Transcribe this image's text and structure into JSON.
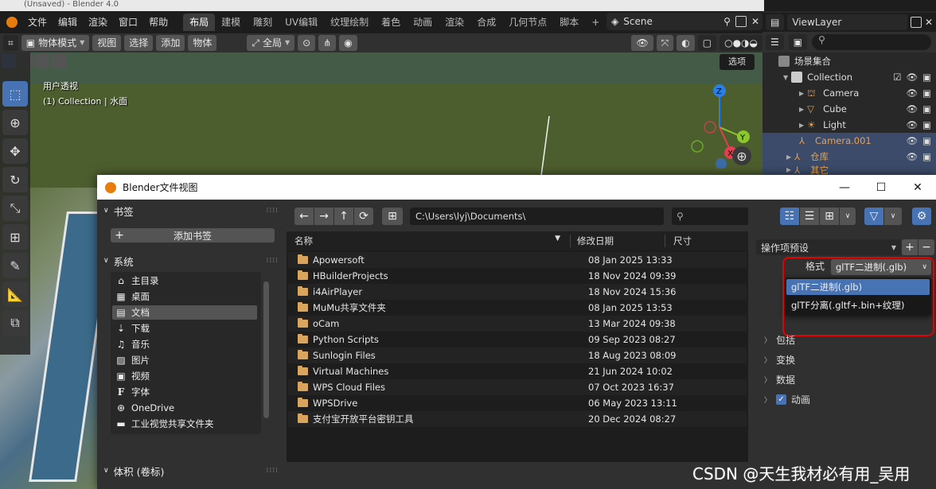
{
  "app": {
    "window_title": "(Unsaved) - Blender 4.0",
    "menu": [
      "文件",
      "编辑",
      "渲染",
      "窗口",
      "帮助"
    ],
    "workspaces": [
      "布局",
      "建模",
      "雕刻",
      "UV编辑",
      "纹理绘制",
      "着色",
      "动画",
      "渲染",
      "合成",
      "几何节点",
      "脚本"
    ],
    "active_workspace": "布局",
    "add_workspace": "+",
    "scene": "Scene",
    "view_layer": "ViewLayer"
  },
  "viewport": {
    "mode": "物体模式",
    "header_menus": [
      "视图",
      "选择",
      "添加",
      "物体"
    ],
    "orientation": "全局",
    "label_view": "用户透视",
    "label_collection": "(1) Collection | 水面",
    "select_button": "选项",
    "gizmo_axes": [
      "Z",
      "Y",
      "X"
    ]
  },
  "outliner": {
    "rows": [
      {
        "label": "场景集合",
        "depth": 0
      },
      {
        "label": "Collection",
        "depth": 1
      },
      {
        "label": "Camera",
        "depth": 2
      },
      {
        "label": "Cube",
        "depth": 2
      },
      {
        "label": "Light",
        "depth": 2
      },
      {
        "label": "Camera.001",
        "depth": 1
      },
      {
        "label": "仓库",
        "depth": 1
      },
      {
        "label": "其它",
        "depth": 1
      }
    ]
  },
  "dialog": {
    "title": "Blender文件视图",
    "bookmarks_header": "书签",
    "add_bookmark": "添加书签",
    "system_header": "系统",
    "system_items": [
      {
        "icon": "home-icon",
        "label": "主目录"
      },
      {
        "icon": "desktop-icon",
        "label": "桌面"
      },
      {
        "icon": "documents-icon",
        "label": "文档"
      },
      {
        "icon": "download-icon",
        "label": "下载"
      },
      {
        "icon": "music-icon",
        "label": "音乐"
      },
      {
        "icon": "picture-icon",
        "label": "图片"
      },
      {
        "icon": "video-icon",
        "label": "视频"
      },
      {
        "icon": "font-icon",
        "label": "字体"
      },
      {
        "icon": "onedrive-icon",
        "label": "OneDrive"
      },
      {
        "icon": "folder-icon",
        "label": "工业视觉共享文件夹"
      }
    ],
    "selected_system_item": "文档",
    "volumes_header": "体积 (卷标)",
    "path": "C:\\Users\\lyj\\Documents\\",
    "columns": {
      "name": "名称",
      "modified": "修改日期",
      "size": "尺寸"
    },
    "files": [
      {
        "name": "Apowersoft",
        "date": "08 Jan 2025 13:33"
      },
      {
        "name": "HBuilderProjects",
        "date": "18 Nov 2024 09:39"
      },
      {
        "name": "i4AirPlayer",
        "date": "18 Nov 2024 15:36"
      },
      {
        "name": "MuMu共享文件夹",
        "date": "08 Jan 2025 13:53"
      },
      {
        "name": "oCam",
        "date": "13 Mar 2024 09:38"
      },
      {
        "name": "Python Scripts",
        "date": "09 Sep 2023 08:27"
      },
      {
        "name": "Sunlogin Files",
        "date": "18 Aug 2023 08:09"
      },
      {
        "name": "Virtual Machines",
        "date": "21 Jun 2024 10:02"
      },
      {
        "name": "WPS Cloud Files",
        "date": "07 Oct 2023 16:37"
      },
      {
        "name": "WPSDrive",
        "date": "06 May 2023 13:11"
      },
      {
        "name": "支付宝开放平台密钥工具",
        "date": "20 Dec 2024 08:27"
      }
    ],
    "operator_presets": "操作项预设",
    "format_label": "格式",
    "format_value": "glTF二进制(.glb)",
    "format_options": [
      "glTF二进制(.glb)",
      "glTF分离(.gltf+.bin+纹理)"
    ],
    "sections": [
      {
        "label": "包括",
        "checkbox": false
      },
      {
        "label": "变换",
        "checkbox": false
      },
      {
        "label": "数据",
        "checkbox": false
      },
      {
        "label": "动画",
        "checkbox": true
      }
    ]
  },
  "watermark": "CSDN @天生我材必有用_吴用",
  "colors": {
    "accent": "#4772b3",
    "highlight_box": "#e60000",
    "folder": "#d9a55d"
  }
}
